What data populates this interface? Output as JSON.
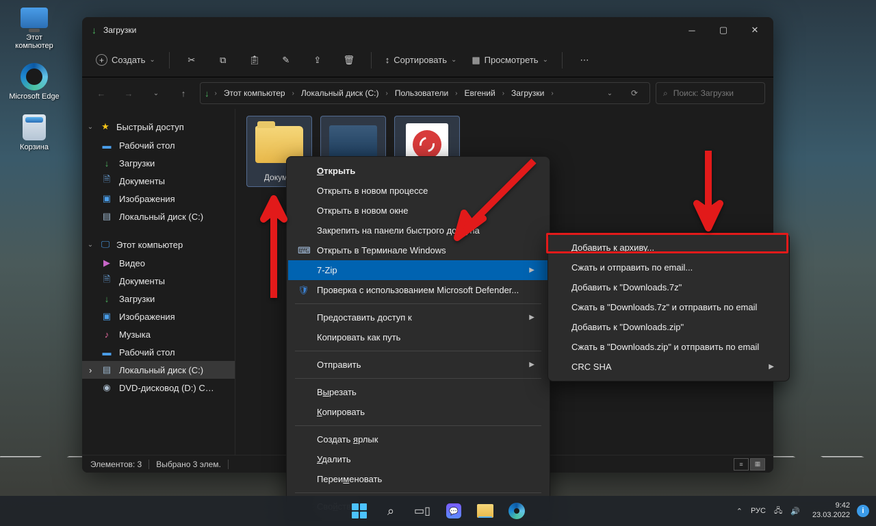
{
  "desktop": {
    "icons": [
      {
        "label": "Этот компьютер"
      },
      {
        "label": "Microsoft Edge"
      },
      {
        "label": "Корзина"
      }
    ]
  },
  "explorer": {
    "title": "Загрузки",
    "toolbar": {
      "create": "Создать",
      "sort": "Сортировать",
      "view": "Просмотреть"
    },
    "breadcrumbs": [
      "Этот компьютер",
      "Локальный диск (C:)",
      "Пользователи",
      "Евгений",
      "Загрузки"
    ],
    "search_placeholder": "Поиск: Загрузки",
    "sidebar": {
      "quick_access": "Быстрый доступ",
      "quick_items": [
        "Рабочий стол",
        "Загрузки",
        "Документы",
        "Изображения",
        "Локальный диск (C:)"
      ],
      "this_pc": "Этот компьютер",
      "pc_items": [
        "Видео",
        "Документы",
        "Загрузки",
        "Изображения",
        "Музыка",
        "Рабочий стол",
        "Локальный диск (C:)",
        "DVD-дисковод (D:) CPBA_X6"
      ]
    },
    "files": [
      {
        "name": "Докум..."
      }
    ],
    "status": {
      "count": "Элементов: 3",
      "selected": "Выбрано 3 элем."
    }
  },
  "context_menu": {
    "open": "Открыть",
    "open_new_process": "Открыть в новом процессе",
    "open_new_window": "Открыть в новом окне",
    "pin_quick": "Закрепить на панели быстрого доступа",
    "open_terminal": "Открыть в Терминале Windows",
    "sevenzip": "7-Zip",
    "defender": "Проверка с использованием Microsoft Defender...",
    "grant_access": "Предоставить доступ к",
    "copy_path": "Копировать как путь",
    "send_to": "Отправить",
    "cut": "Вырезать",
    "copy": "Копировать",
    "shortcut": "Создать ярлык",
    "delete": "Удалить",
    "rename": "Переименовать",
    "properties": "Свойства"
  },
  "submenu": {
    "add_archive": "Добавить к архиву...",
    "compress_email": "Сжать и отправить по email...",
    "add_7z": "Добавить к \"Downloads.7z\"",
    "compress_7z_email": "Сжать в \"Downloads.7z\" и отправить по email",
    "add_zip": "Добавить к \"Downloads.zip\"",
    "compress_zip_email": "Сжать в \"Downloads.zip\" и отправить по email",
    "crc": "CRC SHA"
  },
  "taskbar": {
    "lang": "РУС",
    "time": "9:42",
    "date": "23.03.2022"
  }
}
